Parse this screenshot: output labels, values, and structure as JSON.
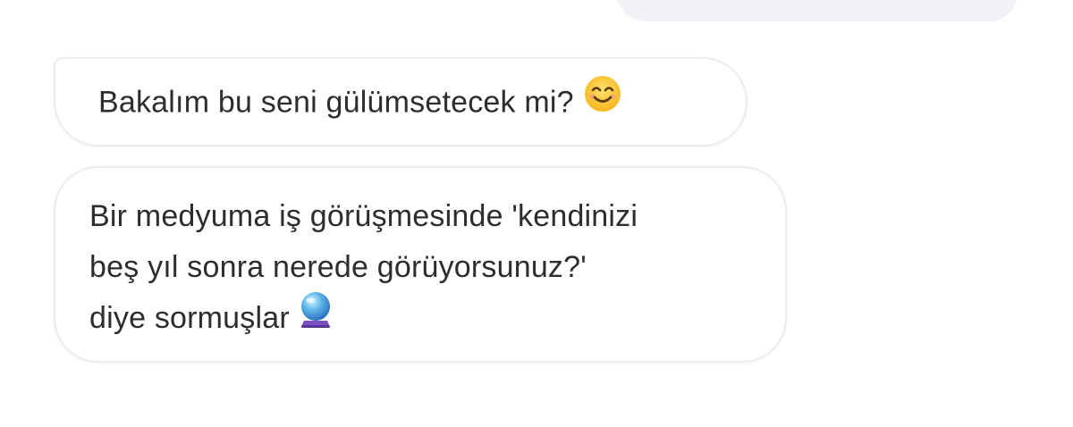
{
  "messages": [
    {
      "direction": "incoming",
      "text": "Bakalım bu seni gülümsetecek mi?",
      "emoji": "smiling-face-icon"
    },
    {
      "direction": "incoming",
      "lines": [
        "Bir medyuma iş görüşmesinde 'kendinizi",
        "beş yıl sonra nerede görüyorsunuz?'",
        "diye sormuşlar"
      ],
      "emoji": "crystal-ball-icon"
    }
  ],
  "colors": {
    "outgoing_bubble": "#f1f2f6",
    "incoming_bubble": "#ffffff",
    "incoming_border": "#ececee",
    "text": "#2d2d2d"
  }
}
